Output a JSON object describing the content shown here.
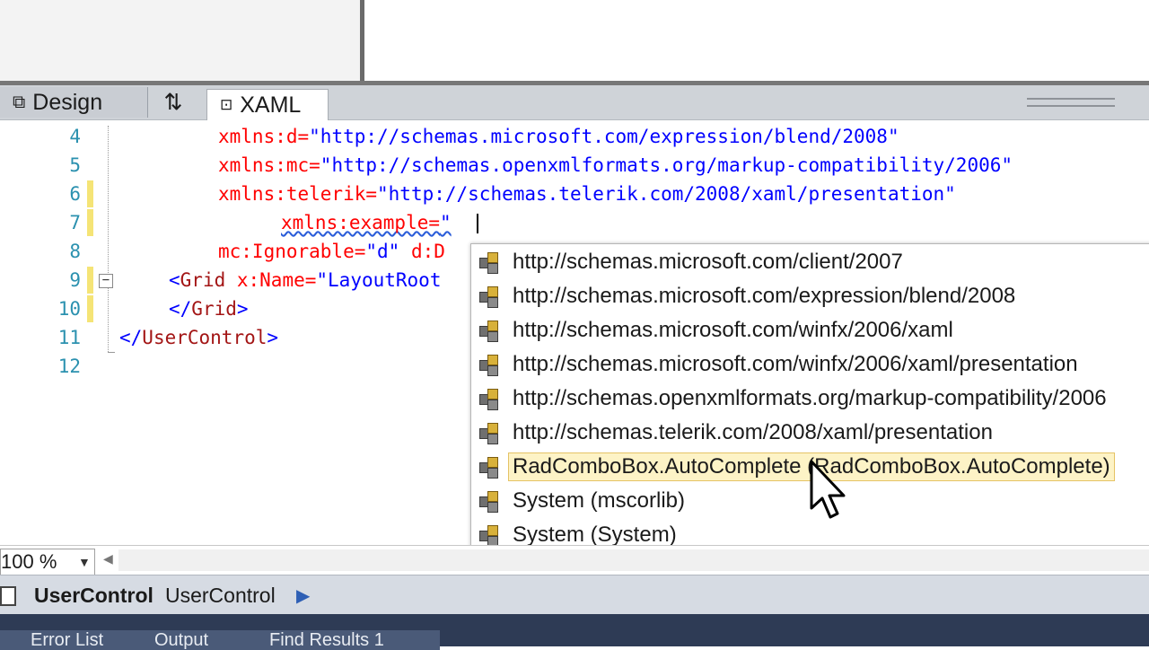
{
  "tabs": {
    "design_label": "Design",
    "swap_label": "⇅",
    "xaml_label": "XAML"
  },
  "code_lines": [
    {
      "num": "4",
      "attr": "xmlns:d=",
      "val": "\"http://schemas.microsoft.com/expression/blend/2008\""
    },
    {
      "num": "5",
      "attr": "xmlns:mc=",
      "val": "\"http://schemas.openxmlformats.org/markup-compatibility/2006\""
    },
    {
      "num": "6",
      "attr": "xmlns:telerik=",
      "val": "\"http://schemas.telerik.com/2008/xaml/presentation\""
    },
    {
      "num": "7",
      "attr": "xmlns:example=",
      "val": "\""
    },
    {
      "num": "8",
      "attr": "mc:Ignorable=",
      "val": "\"d\"",
      "attr2": " d:D"
    },
    {
      "num": "9",
      "tag_open": "<",
      "tag": "Grid",
      "attr": " x:Name=",
      "val": "\"LayoutRoot"
    },
    {
      "num": "10",
      "tag_open": "</",
      "tag": "Grid",
      "tag_close": ">"
    },
    {
      "num": "11",
      "tag_open": "</",
      "tag": "UserControl",
      "tag_close": ">"
    },
    {
      "num": "12"
    }
  ],
  "completion": {
    "items": [
      "http://schemas.microsoft.com/client/2007",
      "http://schemas.microsoft.com/expression/blend/2008",
      "http://schemas.microsoft.com/winfx/2006/xaml",
      "http://schemas.microsoft.com/winfx/2006/xaml/presentation",
      "http://schemas.openxmlformats.org/markup-compatibility/2006",
      "http://schemas.telerik.com/2008/xaml/presentation",
      "RadComboBox.AutoComplete (RadComboBox.AutoComplete)",
      "System (mscorlib)",
      "System (System)"
    ],
    "selected_index": 6
  },
  "zoom": {
    "value": "100 %"
  },
  "breadcrumb": {
    "bold": "UserControl",
    "normal": "UserControl"
  },
  "tool_tabs": [
    "Error List",
    "Output",
    "Find Results 1"
  ],
  "colors": {
    "attribute": "#ff0000",
    "value": "#0000ff",
    "tag": "#a31515",
    "line_number": "#2b91af",
    "selection": "#fdf3c6"
  }
}
